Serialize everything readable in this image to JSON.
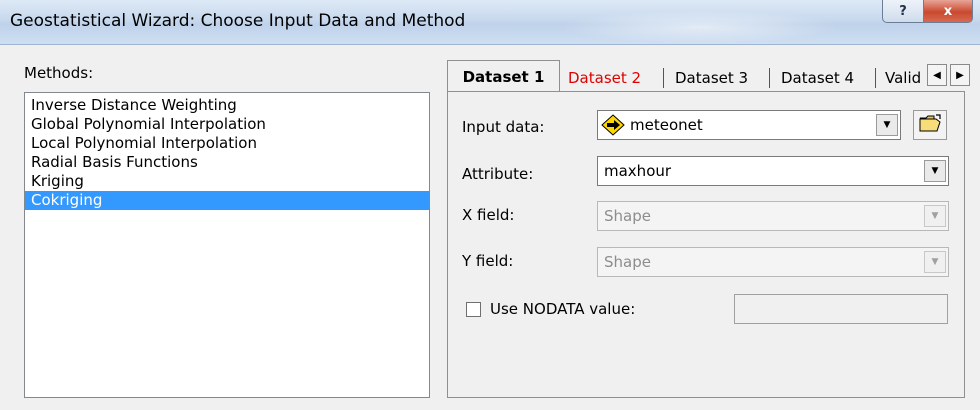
{
  "window": {
    "title": "Geostatistical Wizard: Choose Input Data and Method",
    "help_label": "?",
    "close_label": "x"
  },
  "methods": {
    "label": "Methods:",
    "items": [
      {
        "label": "Inverse Distance Weighting"
      },
      {
        "label": "Global Polynomial Interpolation"
      },
      {
        "label": "Local Polynomial Interpolation"
      },
      {
        "label": "Radial Basis Functions"
      },
      {
        "label": "Kriging"
      },
      {
        "label": "Cokriging"
      }
    ],
    "selected": "Cokriging"
  },
  "tabs": [
    {
      "label": "Dataset 1",
      "state": "active"
    },
    {
      "label": "Dataset 2",
      "state": "red"
    },
    {
      "label": "Dataset 3"
    },
    {
      "label": "Dataset 4"
    },
    {
      "label": "Valid"
    }
  ],
  "dataset": {
    "input_data_label": "Input data:",
    "input_data_value": "meteonet",
    "attribute_label": "Attribute:",
    "attribute_value": "maxhour",
    "x_field_label": "X field:",
    "x_field_value": "Shape",
    "y_field_label": "Y field:",
    "y_field_value": "Shape",
    "nodata_label": "Use NODATA value:",
    "nodata_checked": false,
    "nodata_value": ""
  },
  "colors": {
    "selection": "#3399ff",
    "highlight_tab_text": "#e00000",
    "dataset_icon": "#ffd700"
  }
}
